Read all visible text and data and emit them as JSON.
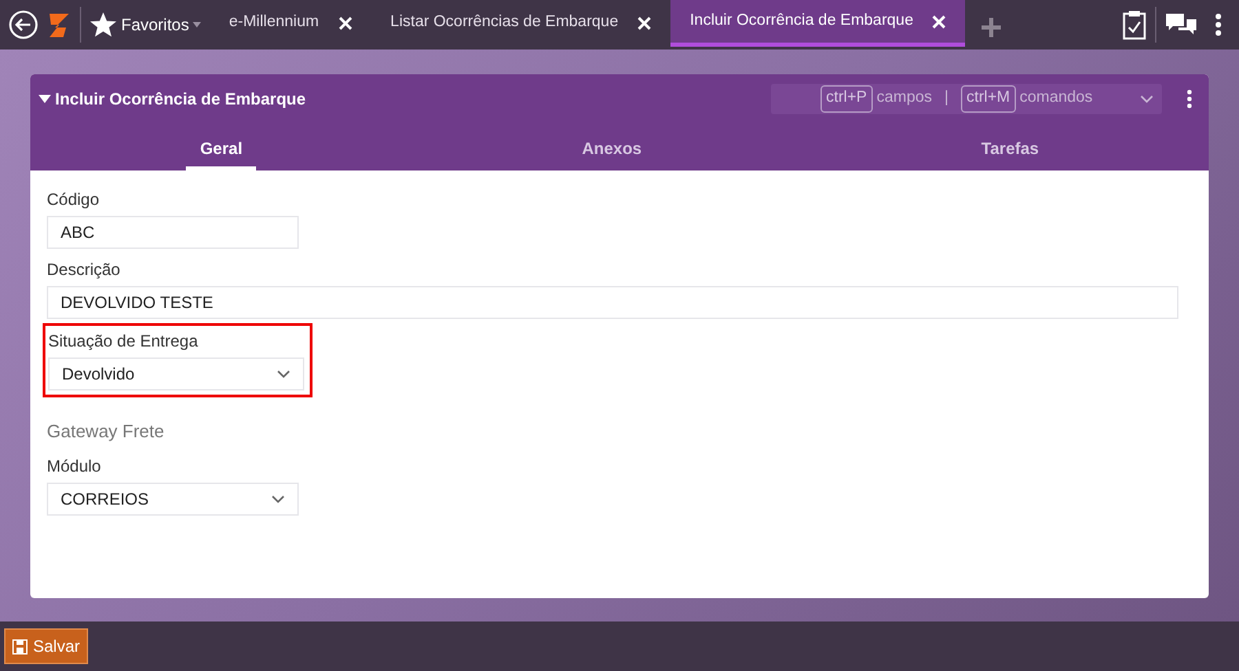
{
  "topbar": {
    "favorites": "Favoritos",
    "tabs": [
      {
        "label": "e-Millennium",
        "selected": false
      },
      {
        "label": "Listar Ocorrências de Embarque",
        "selected": false
      },
      {
        "label": "Incluir Ocorrência de Embarque",
        "selected": true
      }
    ]
  },
  "panel": {
    "title": "Incluir Ocorrência de Embarque",
    "shortcuts": [
      {
        "key": "ctrl+P",
        "label": "campos"
      },
      {
        "key": "ctrl+M",
        "label": "comandos"
      }
    ],
    "separator": "|",
    "subtabs": [
      {
        "label": "Geral",
        "selected": true
      },
      {
        "label": "Anexos",
        "selected": false
      },
      {
        "label": "Tarefas",
        "selected": false
      }
    ],
    "fields": [
      {
        "kind": "input",
        "label": "Código",
        "value": "ABC",
        "wide": false,
        "highlighted": false
      },
      {
        "kind": "input",
        "label": "Descrição",
        "value": "DEVOLVIDO TESTE",
        "wide": true,
        "highlighted": false
      },
      {
        "kind": "select",
        "label": "Situação de Entrega",
        "value": "Devolvido",
        "wide": false,
        "highlighted": true
      },
      {
        "kind": "section",
        "label": "Gateway Frete"
      },
      {
        "kind": "select",
        "label": "Módulo",
        "value": "CORREIOS",
        "wide": false,
        "highlighted": false
      }
    ]
  },
  "footer": {
    "save": "Salvar"
  }
}
